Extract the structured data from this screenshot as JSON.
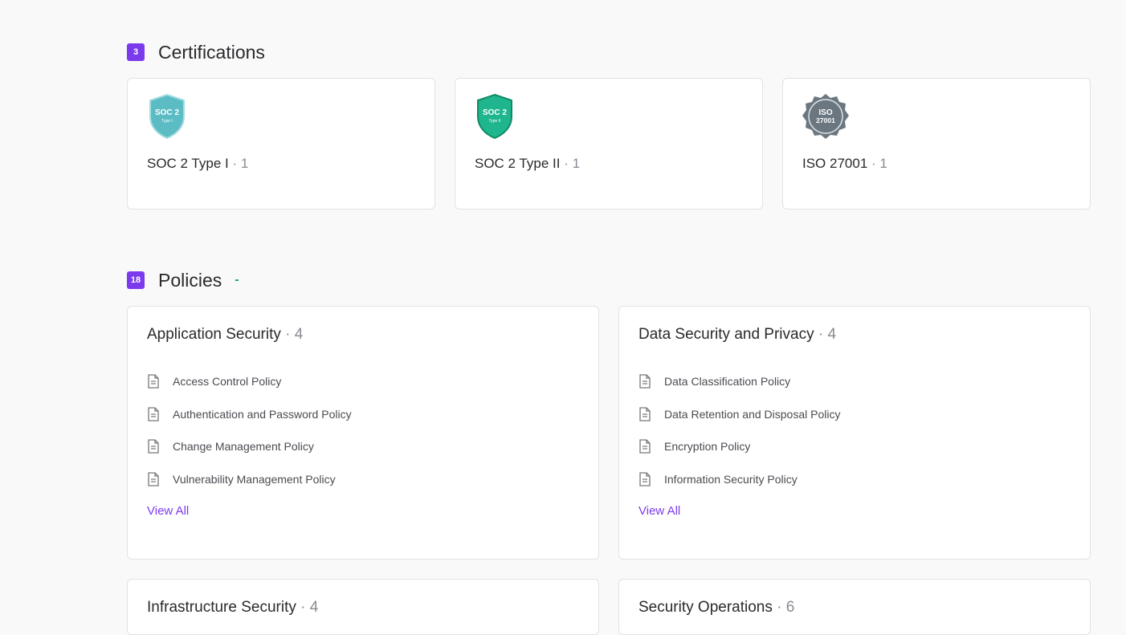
{
  "certifications": {
    "count": "3",
    "title": "Certifications",
    "items": [
      {
        "name": "SOC 2 Type I",
        "sep": "·",
        "count": "1",
        "badge_top": "SOC 2",
        "badge_bottom": "Type I",
        "color": "#5bbcc4"
      },
      {
        "name": "SOC 2 Type II",
        "sep": "·",
        "count": "1",
        "badge_top": "SOC 2",
        "badge_bottom": "Type II",
        "color": "#1fb68d"
      },
      {
        "name": "ISO 27001",
        "sep": "·",
        "count": "1",
        "badge_top": "ISO",
        "badge_bottom": "27001",
        "color": "#6b7780"
      }
    ]
  },
  "policies": {
    "count": "18",
    "title": "Policies",
    "dash": "-",
    "view_all_label": "View All",
    "groups": [
      {
        "title": "Application Security",
        "sep": "·",
        "count": "4",
        "items": [
          "Access Control Policy",
          "Authentication and Password Policy",
          "Change Management Policy",
          "Vulnerability Management Policy"
        ]
      },
      {
        "title": "Data Security and Privacy",
        "sep": "·",
        "count": "4",
        "items": [
          "Data Classification Policy",
          "Data Retention and Disposal Policy",
          "Encryption Policy",
          "Information Security Policy"
        ]
      },
      {
        "title": "Infrastructure Security",
        "sep": "·",
        "count": "4",
        "items": []
      },
      {
        "title": "Security Operations",
        "sep": "·",
        "count": "6",
        "items": []
      }
    ]
  },
  "colors": {
    "accent": "#7c3aed",
    "dash": "#1aa67a"
  },
  "icons": {
    "document": "document-icon",
    "shield": "shield-icon",
    "seal": "seal-icon"
  }
}
